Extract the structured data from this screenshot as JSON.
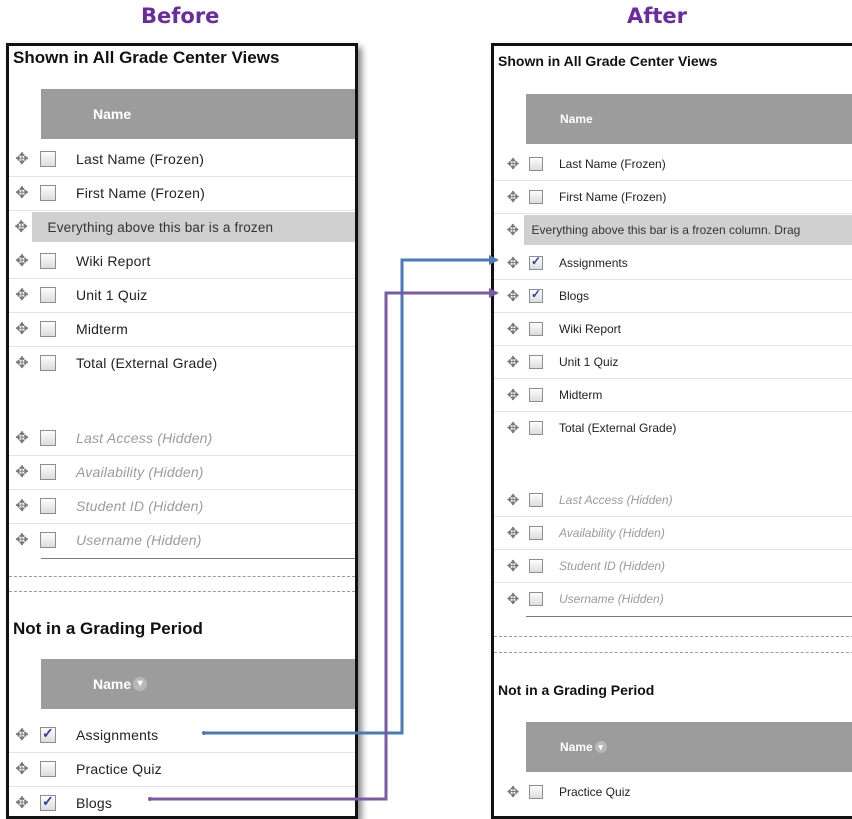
{
  "captions": {
    "before": "Before",
    "after": "After"
  },
  "colors": {
    "caption": "#6a2aa0",
    "arrow_blue": "#4a7ab8",
    "arrow_purple": "#7a5aa6",
    "header_bg": "#9c9c9c"
  },
  "before": {
    "section1_title": "Shown in All Grade Center Views",
    "header_name": "Name",
    "rows": [
      {
        "label": "Last Name (Frozen)",
        "checked": false,
        "hidden": false
      },
      {
        "label": "First Name (Frozen)",
        "checked": false,
        "hidden": false
      },
      {
        "label": "Everything above this bar is a frozen",
        "frozen_bar": true
      },
      {
        "label": "Wiki Report",
        "checked": false,
        "hidden": false
      },
      {
        "label": "Unit 1 Quiz",
        "checked": false,
        "hidden": false
      },
      {
        "label": "Midterm",
        "checked": false,
        "hidden": false
      },
      {
        "label": "Total (External Grade)",
        "checked": false,
        "hidden": false
      }
    ],
    "hidden_rows": [
      {
        "label": "Last Access (Hidden)"
      },
      {
        "label": "Availability (Hidden)"
      },
      {
        "label": "Student ID (Hidden)"
      },
      {
        "label": "Username (Hidden)"
      }
    ],
    "section2_title": "Not in a Grading Period",
    "header2_name": "Name",
    "rows2": [
      {
        "label": "Assignments",
        "checked": true
      },
      {
        "label": "Practice Quiz",
        "checked": false
      },
      {
        "label": "Blogs",
        "checked": true
      }
    ]
  },
  "after": {
    "section1_title": "Shown in All Grade Center Views",
    "header_name": "Name",
    "rows": [
      {
        "label": "Last Name (Frozen)",
        "checked": false
      },
      {
        "label": "First Name (Frozen)",
        "checked": false
      },
      {
        "label": "Everything above this bar is a frozen column. Drag",
        "frozen_bar": true
      },
      {
        "label": "Assignments",
        "checked": true
      },
      {
        "label": "Blogs",
        "checked": true
      },
      {
        "label": "Wiki Report",
        "checked": false
      },
      {
        "label": "Unit 1 Quiz",
        "checked": false
      },
      {
        "label": "Midterm",
        "checked": false
      },
      {
        "label": "Total (External Grade)",
        "checked": false
      }
    ],
    "hidden_rows": [
      {
        "label": "Last Access (Hidden)"
      },
      {
        "label": "Availability (Hidden)"
      },
      {
        "label": "Student ID (Hidden)"
      },
      {
        "label": "Username (Hidden)"
      }
    ],
    "section2_title": "Not in a Grading Period",
    "header2_name": "Name",
    "rows2": [
      {
        "label": "Practice Quiz",
        "checked": false
      }
    ]
  }
}
